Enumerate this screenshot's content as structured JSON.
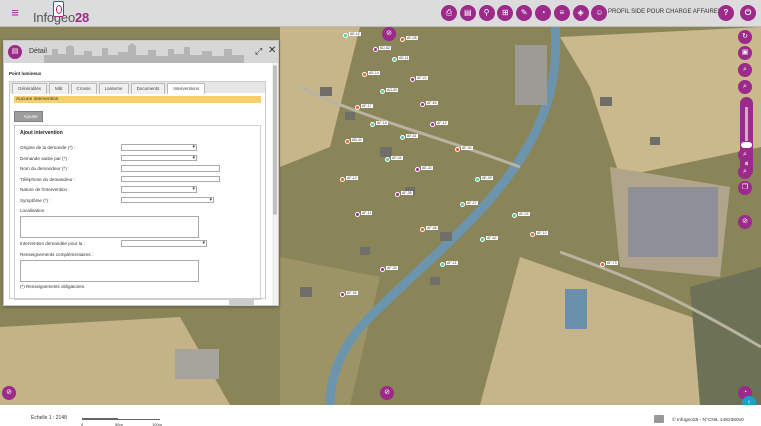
{
  "app": {
    "logo_prefix": "Infogeo",
    "logo_number": "28",
    "profile": "PROFIL SIDE POUR CHARGE AFFAIRES"
  },
  "toolbar_icons": [
    "print-icon",
    "table-icon",
    "route-icon",
    "layers-export-icon",
    "pencil-icon",
    "measure-icon",
    "list-add-icon",
    "layers-icon",
    "pedestrian-icon"
  ],
  "toolbar_glyphs": [
    "⎙",
    "▤",
    "⚲",
    "⊞",
    "✎",
    "◔",
    "≡",
    "◈",
    "☺"
  ],
  "help_glyph": "?",
  "power_glyph": "⏻",
  "colors": {
    "accent": "#9b2a8a",
    "warning": "#f5d06c",
    "teal": "#16a3c7"
  },
  "panel": {
    "title": "Détail",
    "object_title": "Point lumineux",
    "tabs": [
      "Généralités",
      "Mât",
      "Crosse",
      "Lanterne",
      "Documents",
      "Interventions"
    ],
    "active_tab": "Interventions",
    "no_intervention": "Aucune intervention",
    "add_button": "Ajouter",
    "form_title": "Ajout intervention",
    "fields": [
      {
        "label": "Origine de la demande (*) :",
        "kind": "select"
      },
      {
        "label": "Demande saisie par (*) :",
        "kind": "select"
      },
      {
        "label": "Nom du demandeur (*) :",
        "kind": "input"
      },
      {
        "label": "Téléphone du demandeur :",
        "kind": "input"
      },
      {
        "label": "Nature de l'intervention :",
        "kind": "select"
      },
      {
        "label": "Symptôme (*) :",
        "kind": "select_wide"
      }
    ],
    "localisation_label": "Localisation",
    "demanded_for_label": "Intervention demandée pour la :",
    "renseignements_label": "Renseignements complémentaires :",
    "required_note": "(*) Renseignements obligatoires."
  },
  "map": {
    "point_labels": [
      "AE-12",
      "AD-52",
      "AF-06",
      "AE-11",
      "AE-14",
      "AF-22",
      "AG-52",
      "AF-17",
      "AF-69",
      "AF-15",
      "AF-61",
      "AF-12",
      "AB-42",
      "AF-04",
      "AF-30",
      "AE-32",
      "AE-09",
      "AF-13",
      "AF-38",
      "AF-27",
      "AF-02",
      "AF-11",
      "AF-48",
      "AF-62",
      "AF-10",
      "AF-33",
      "AF-21",
      "AF-73",
      "AF-36"
    ]
  },
  "status": {
    "scale_label": "Echelle 1 : 2148",
    "scale_ticks": [
      "0",
      "50m",
      "100m"
    ],
    "copyright": "© Infogeo28 - N°CNIL 1482360v0"
  }
}
